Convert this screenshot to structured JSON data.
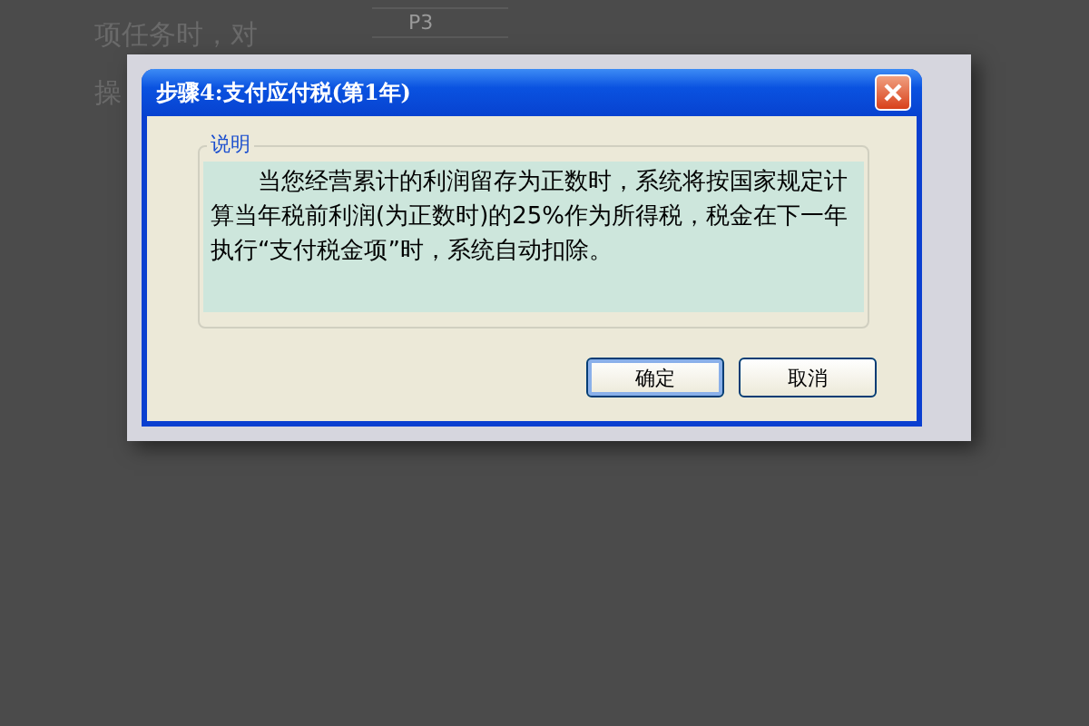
{
  "background": {
    "text_lines": [
      "项任务时，对",
      "操"
    ],
    "table_row_label": "P3"
  },
  "dialog": {
    "title": "步骤4:支付应付税(第1年)",
    "group_label": "说明",
    "message": "当您经营累计的利润留存为正数时，系统将按国家规定计算当年税前利润(为正数时)的25%作为所得税，税金在下一年执行“支付税金项”时，系统自动扣除。",
    "buttons": [
      {
        "label": "确定",
        "selected": true
      },
      {
        "label": "取消",
        "selected": false
      }
    ]
  }
}
